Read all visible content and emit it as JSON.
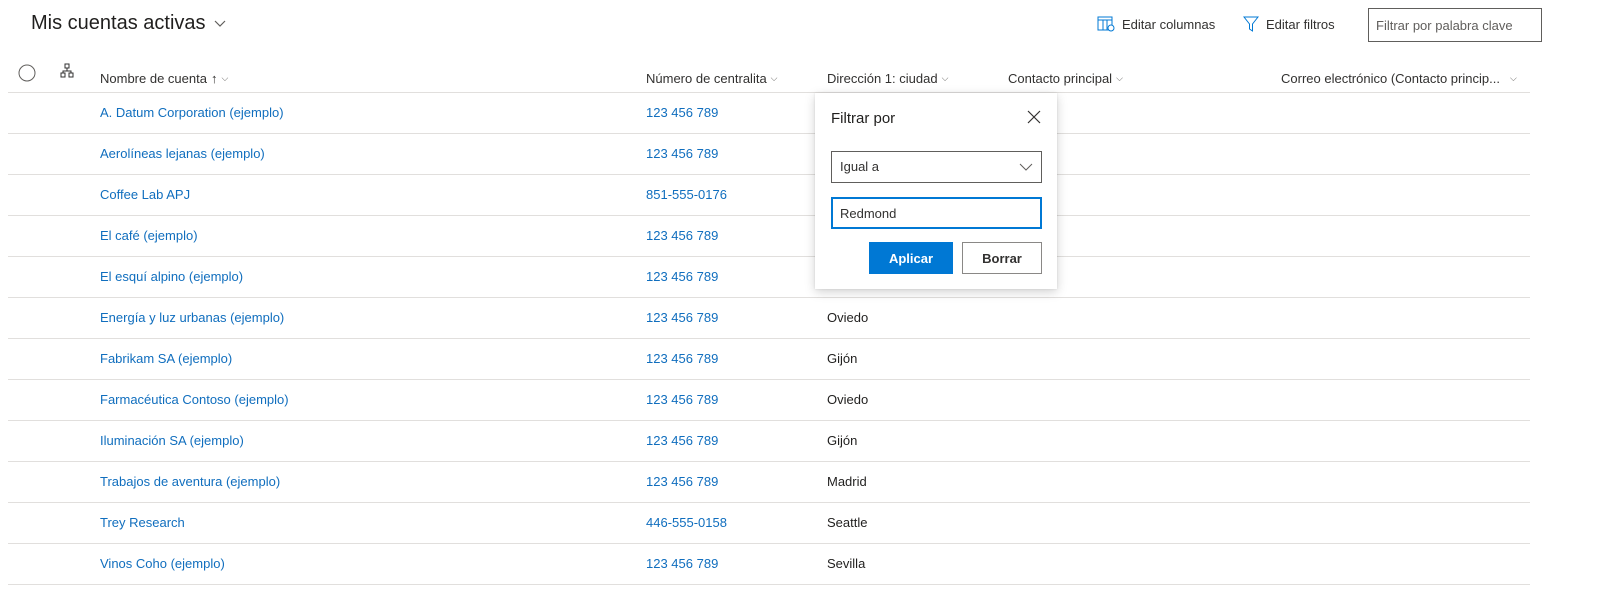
{
  "header": {
    "title": "Mis cuentas activas",
    "edit_columns": "Editar columnas",
    "edit_filters": "Editar filtros",
    "search_placeholder": "Filtrar por palabra clave"
  },
  "columns": {
    "name": "Nombre de cuenta",
    "phone": "Número de centralita",
    "city": "Dirección 1: ciudad",
    "contact": "Contacto principal",
    "email": "Correo electrónico (Contacto princip..."
  },
  "sort": {
    "column": "name",
    "direction": "ascending"
  },
  "rows": [
    {
      "name": "A. Datum Corporation (ejemplo)",
      "phone": "123 456 789",
      "city": ""
    },
    {
      "name": "Aerolíneas lejanas (ejemplo)",
      "phone": "123 456 789",
      "city": ""
    },
    {
      "name": "Coffee Lab APJ",
      "phone": "851-555-0176",
      "city": ""
    },
    {
      "name": "El café (ejemplo)",
      "phone": "123 456 789",
      "city": ""
    },
    {
      "name": "El esquí alpino (ejemplo)",
      "phone": "123 456 789",
      "city": ""
    },
    {
      "name": "Energía y luz urbanas (ejemplo)",
      "phone": "123 456 789",
      "city": "Oviedo"
    },
    {
      "name": "Fabrikam SA (ejemplo)",
      "phone": "123 456 789",
      "city": "Gijón"
    },
    {
      "name": "Farmacéutica Contoso (ejemplo)",
      "phone": "123 456 789",
      "city": "Oviedo"
    },
    {
      "name": "Iluminación SA (ejemplo)",
      "phone": "123 456 789",
      "city": "Gijón"
    },
    {
      "name": "Trabajos de aventura (ejemplo)",
      "phone": "123 456 789",
      "city": "Madrid"
    },
    {
      "name": "Trey Research",
      "phone": "446-555-0158",
      "city": "Seattle"
    },
    {
      "name": "Vinos Coho (ejemplo)",
      "phone": "123 456 789",
      "city": "Sevilla"
    }
  ],
  "filter_popup": {
    "title": "Filtrar por",
    "operator": "Igual a",
    "value": "Redmond",
    "apply": "Aplicar",
    "clear": "Borrar"
  },
  "colors": {
    "accent": "#0078d4",
    "link": "#106ebe"
  }
}
